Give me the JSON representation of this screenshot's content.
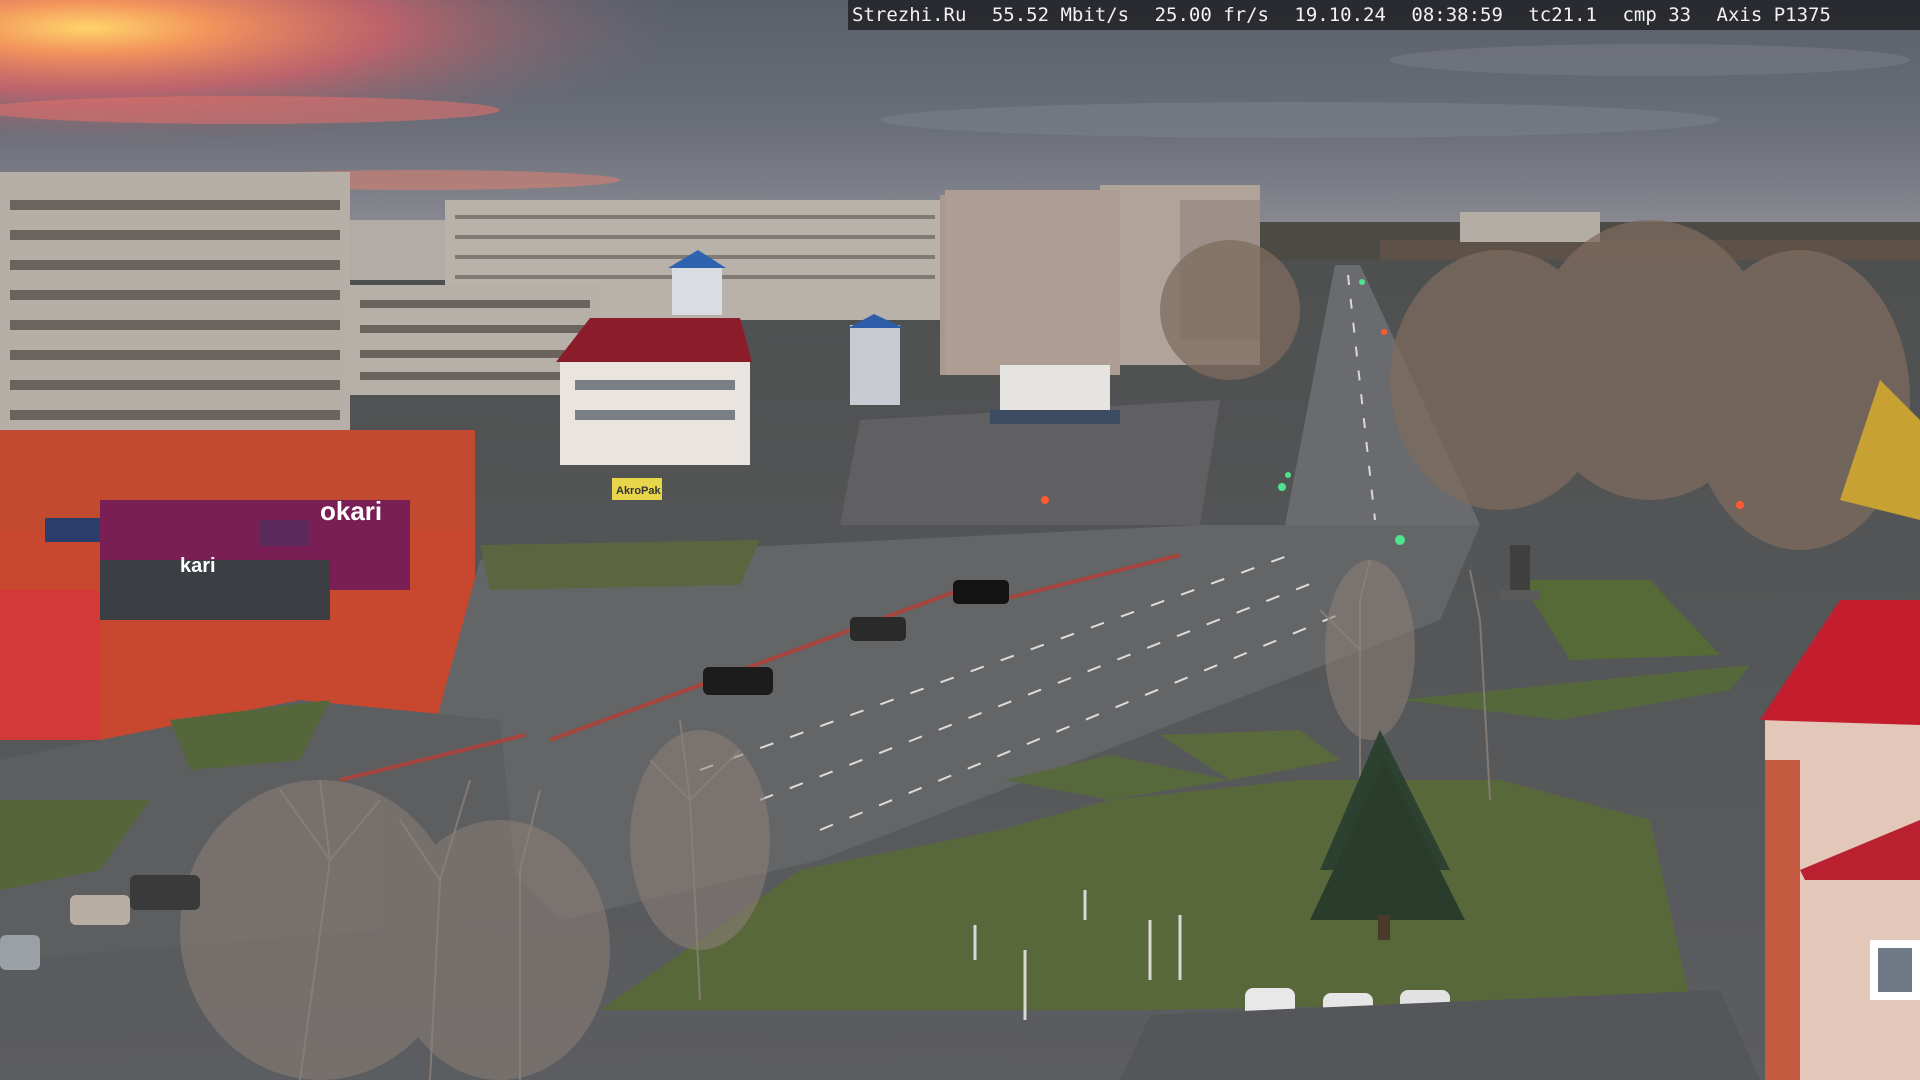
{
  "overlay": {
    "site": "Strezhi.Ru",
    "bitrate": "55.52 Mbit/s",
    "framerate": "25.00 fr/s",
    "date": "19.10.24",
    "time": "08:38:59",
    "tc": "tc21.1",
    "cmp": "cmp 33",
    "camera_model": "Axis P1375"
  },
  "signs": {
    "store_brand": "kari",
    "store_sign_main": "okari",
    "small_sign": "AkroPak"
  },
  "colors": {
    "sky_top": "#4f5662",
    "sky_sunset": "#f08a5a",
    "road": "#5f6063",
    "grass": "#5a6b3a",
    "store_red": "#c8482f",
    "store_purple": "#7a1f55",
    "roof_red": "#c41e2e"
  }
}
